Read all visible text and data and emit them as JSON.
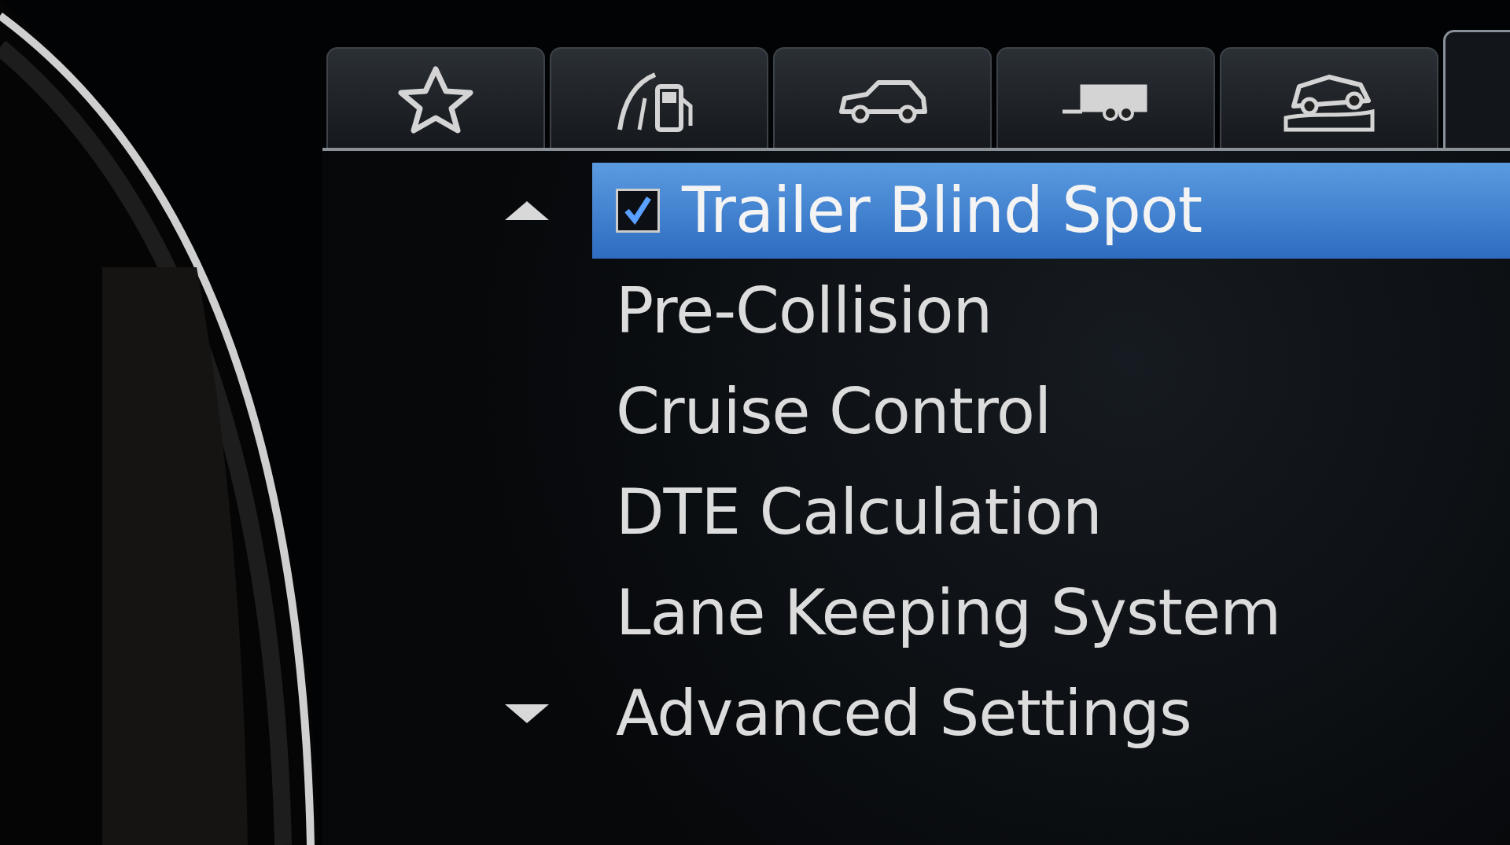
{
  "tabs": [
    {
      "kind": "star",
      "selected": false
    },
    {
      "kind": "fuel",
      "selected": false
    },
    {
      "kind": "car",
      "selected": false
    },
    {
      "kind": "trailer",
      "selected": false
    },
    {
      "kind": "offroad",
      "selected": false
    },
    {
      "kind": "blank",
      "selected": true
    }
  ],
  "menu": {
    "items": [
      {
        "label": "Trailer Blind Spot",
        "kind": "checkbox",
        "checked": true,
        "selected": true
      },
      {
        "label": "Pre-Collision",
        "kind": "plain",
        "selected": false
      },
      {
        "label": "Cruise Control",
        "kind": "plain",
        "selected": false
      },
      {
        "label": "DTE Calculation",
        "kind": "plain",
        "selected": false
      },
      {
        "label": "Lane Keeping System",
        "kind": "plain",
        "selected": false
      },
      {
        "label": "Advanced Settings",
        "kind": "plain",
        "selected": false
      }
    ]
  }
}
